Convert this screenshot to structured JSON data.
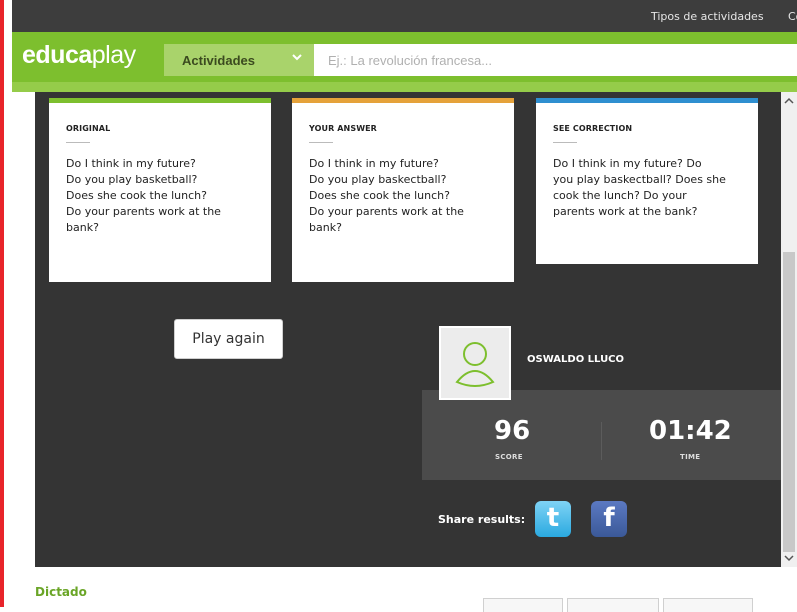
{
  "topbar": {
    "link_activity_types": "Tipos de actividades",
    "link_cut": "Co"
  },
  "header": {
    "logo_bold": "educa",
    "logo_light": "play",
    "activities_label": "Actividades",
    "search_placeholder": "Ej.: La revolución francesa..."
  },
  "cards": {
    "original": {
      "title": "ORIGINAL",
      "lines": [
        "Do I think in my future?",
        "Do you play basketball?",
        "Does she cook the lunch?",
        "Do your parents work at the",
        "bank?"
      ],
      "bar_color": "#7dbf2e"
    },
    "answer": {
      "title": "YOUR ANSWER",
      "lines": [
        "Do I think in my future?",
        "Do you play baskectball?",
        "Does she cook the lunch?",
        "Do your parents work at the",
        "bank?"
      ],
      "bar_color": "#e5a23a"
    },
    "correction": {
      "title": "SEE CORRECTION",
      "lines": [
        "Do I think in my future? Do",
        "you play baskectball? Does she",
        "cook the lunch? Do your",
        "parents work at the bank?"
      ],
      "bar_color": "#2f8fd0"
    }
  },
  "actions": {
    "play_again": "Play again"
  },
  "profile": {
    "username": "OSWALDO LLUCO",
    "score": "96",
    "score_label": "SCORE",
    "time": "01:42",
    "time_label": "TIME"
  },
  "share": {
    "label": "Share results:"
  },
  "footer": {
    "title": "Dictado"
  }
}
